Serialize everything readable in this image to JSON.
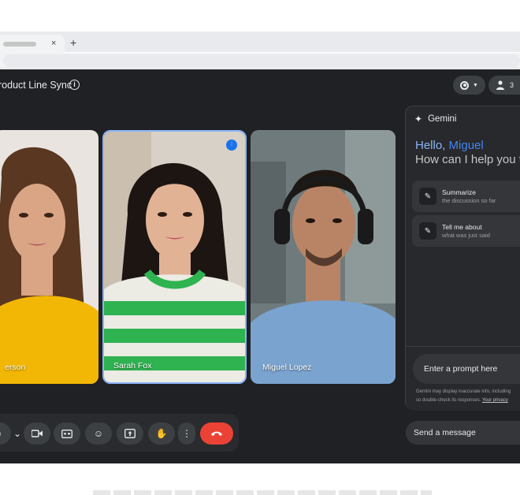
{
  "browser": {
    "tab_close": "×",
    "new_tab": "+"
  },
  "meeting": {
    "title": "roduct Line Sync",
    "info_icon": "i",
    "record_icon": "record-icon",
    "participants_count": "3"
  },
  "participants": [
    {
      "name": "erson",
      "shirt": "#f2b705",
      "skin": "#d9a585",
      "hair": "#5a3720",
      "bg": "#e9e4df",
      "speaking": false
    },
    {
      "name": "Sarah Fox",
      "shirt": "#2fb350",
      "skin": "#e2b295",
      "hair": "#1c1512",
      "bg": "#d8d1c8",
      "speaking": true
    },
    {
      "name": "Miguel Lopez",
      "shirt": "#7ba3cf",
      "skin": "#b98466",
      "hair": "#1f1812",
      "bg": "#6f7a7c",
      "speaking": false
    }
  ],
  "controls": [
    {
      "name": "chevron-down-icon",
      "glyph": "⌄"
    },
    {
      "name": "camera-icon",
      "glyph": "▶"
    },
    {
      "name": "captions-icon",
      "glyph": "CC"
    },
    {
      "name": "emoji-icon",
      "glyph": "☺"
    },
    {
      "name": "present-icon",
      "glyph": "⇧"
    },
    {
      "name": "raise-hand-icon",
      "glyph": "✋"
    },
    {
      "name": "more-icon",
      "glyph": "⋮"
    },
    {
      "name": "end-call-icon",
      "glyph": "☎"
    }
  ],
  "gemini": {
    "title": "Gemini",
    "hello": "Hello, ",
    "user": "Miguel",
    "subtitle": "How can I help you t",
    "suggestions": [
      {
        "title": "Summarize",
        "subtitle": "the discussion so far"
      },
      {
        "title": "Tell me about",
        "subtitle": "what was just said"
      }
    ],
    "prompt_placeholder": "Enter a prompt here",
    "disclaimer_line1": "Gemini may display inaccurate info, including",
    "disclaimer_line2": "so double-check its responses. ",
    "disclaimer_link": "Your privacy"
  },
  "chat": {
    "send_placeholder": "Send a message"
  },
  "colors": {
    "meet_bg": "#202124",
    "accent_blue": "#8ab4f8",
    "end_call_red": "#ea4335"
  }
}
